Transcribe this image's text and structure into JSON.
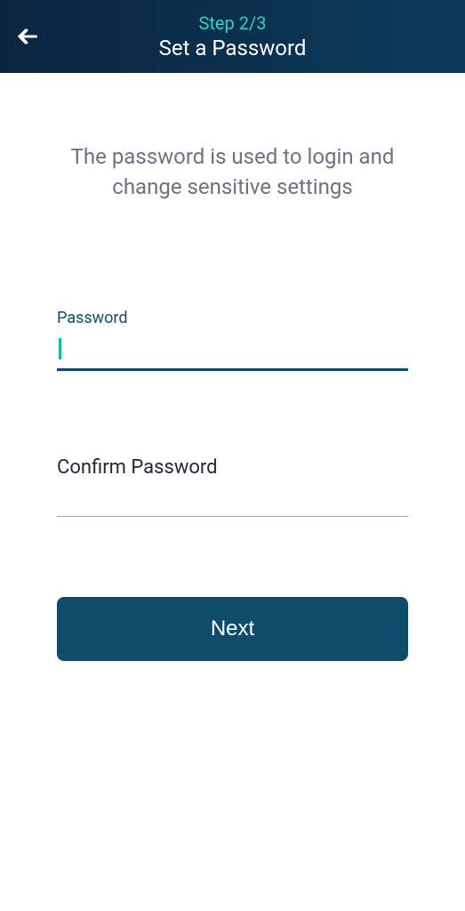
{
  "header": {
    "step_indicator": "Step 2/3",
    "title": "Set a Password"
  },
  "body": {
    "description": "The password is used to login and change sensitive settings",
    "password_label": "Password",
    "confirm_label": "Confirm Password",
    "next_button": "Next"
  }
}
